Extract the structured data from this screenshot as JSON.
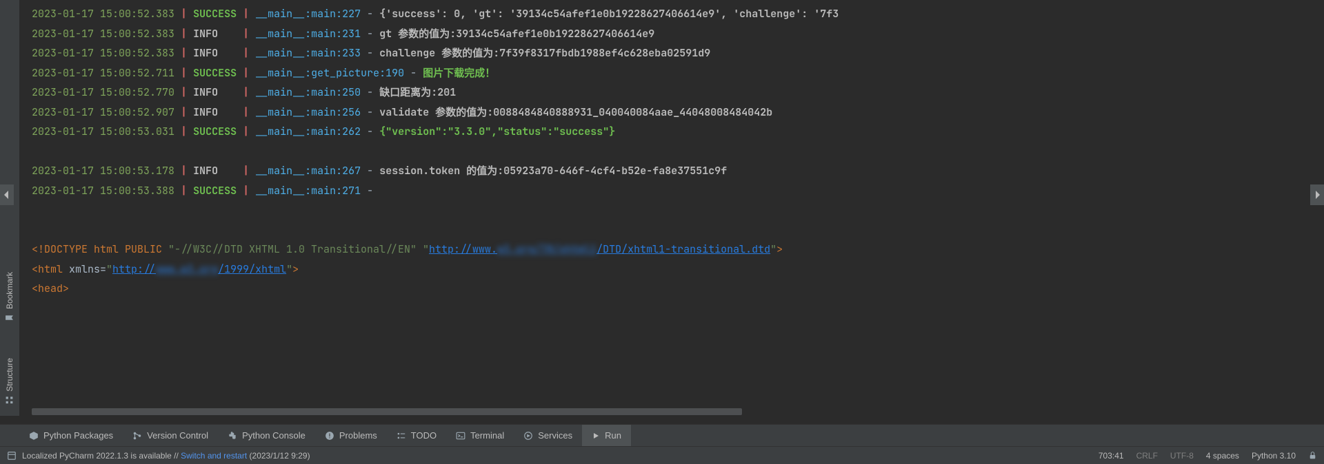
{
  "gutter": {
    "bookmark": "Bookmark",
    "structure": "Structure"
  },
  "log": [
    {
      "ts": "2023-01-17 15:00:52.383",
      "level": "SUCCESS",
      "loc": "__main__:main:227",
      "msg": "{'success': 0, 'gt': '39134c54afef1e0b19228627406614e9', 'challenge': '7f3",
      "green": false
    },
    {
      "ts": "2023-01-17 15:00:52.383",
      "level": "INFO",
      "loc": "__main__:main:231",
      "msg": "gt 参数的值为:39134c54afef1e0b19228627406614e9",
      "green": false
    },
    {
      "ts": "2023-01-17 15:00:52.383",
      "level": "INFO",
      "loc": "__main__:main:233",
      "msg": "challenge 参数的值为:7f39f8317fbdb1988ef4c628eba02591d9",
      "green": false
    },
    {
      "ts": "2023-01-17 15:00:52.711",
      "level": "SUCCESS",
      "loc": "__main__:get_picture:190",
      "msg": "图片下载完成！",
      "green": true
    },
    {
      "ts": "2023-01-17 15:00:52.770",
      "level": "INFO",
      "loc": "__main__:main:250",
      "msg": "缺口距离为:201",
      "green": false
    },
    {
      "ts": "2023-01-17 15:00:52.907",
      "level": "INFO",
      "loc": "__main__:main:256",
      "msg": "validate 参数的值为:0088484840888931_040040084aae_44048008484042b",
      "green": false
    },
    {
      "ts": "2023-01-17 15:00:53.031",
      "level": "SUCCESS",
      "loc": "__main__:main:262",
      "msg": "{\"version\":\"3.3.0\",\"status\":\"success\"}",
      "green": true
    },
    {
      "blank": true
    },
    {
      "ts": "2023-01-17 15:00:53.178",
      "level": "INFO",
      "loc": "__main__:main:267",
      "msg": "session.token 的值为:05923a70-646f-4cf4-b52e-fa8e37551c9f",
      "green": false
    },
    {
      "ts": "2023-01-17 15:00:53.388",
      "level": "SUCCESS",
      "loc": "__main__:main:271",
      "msg": "",
      "green": false
    },
    {
      "blank": true
    },
    {
      "blank": true
    }
  ],
  "html_output": {
    "doctype_pre": "<!DOCTYPE html PUBLIC ",
    "doctype_q1": "\"-//W3C//DTD XHTML 1.0 Transitional//EN\" ",
    "doctype_q2_open": "\"",
    "link1_a": "http://www.",
    "link1_blur": "w3.org/TR/xhtml1",
    "link1_b": "/DTD/xhtml1-transitional.dtd",
    "doctype_q2_close": "\"",
    "doctype_end": ">",
    "html_open": "<html ",
    "xmlns_key": "xmlns=",
    "xmlns_q_open": "\"",
    "link2_a": "http://",
    "link2_blur": "www.w3.org",
    "link2_b": "/1999/xhtml",
    "xmlns_q_close": "\"",
    "html_close": ">",
    "head": "<head>"
  },
  "tools": {
    "packages": "Python Packages",
    "vcs": "Version Control",
    "console": "Python Console",
    "problems": "Problems",
    "todo": "TODO",
    "terminal": "Terminal",
    "services": "Services",
    "run": "Run"
  },
  "status": {
    "message_pre": "Localized PyCharm 2022.1.3 is available // ",
    "message_link": "Switch and restart",
    "message_post": " (2023/1/12 9:29)",
    "pos": "703:41",
    "sep": "CRLF",
    "enc": "UTF-8",
    "indent": "4 spaces",
    "interp": "Python 3.10"
  }
}
